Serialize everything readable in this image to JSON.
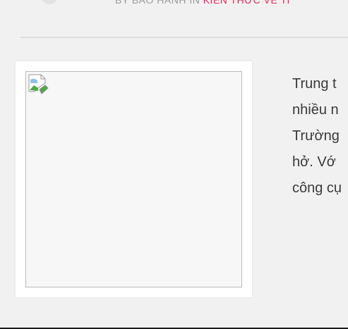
{
  "post_meta": {
    "by_prefix": "BY BẢO HÀNH IN",
    "category": "KIẾN THỨC VỀ TI"
  },
  "thumbnail": {
    "icon": "broken-image-icon"
  },
  "excerpt_lines": [
    "Trung t",
    "nhiều n",
    "Trường",
    "hở. Vớ",
    "công cụ"
  ],
  "colors": {
    "accent": "#e8265a",
    "background": "#f1f1f1",
    "text": "#3a3a3a",
    "meta": "#9a9a9a"
  }
}
